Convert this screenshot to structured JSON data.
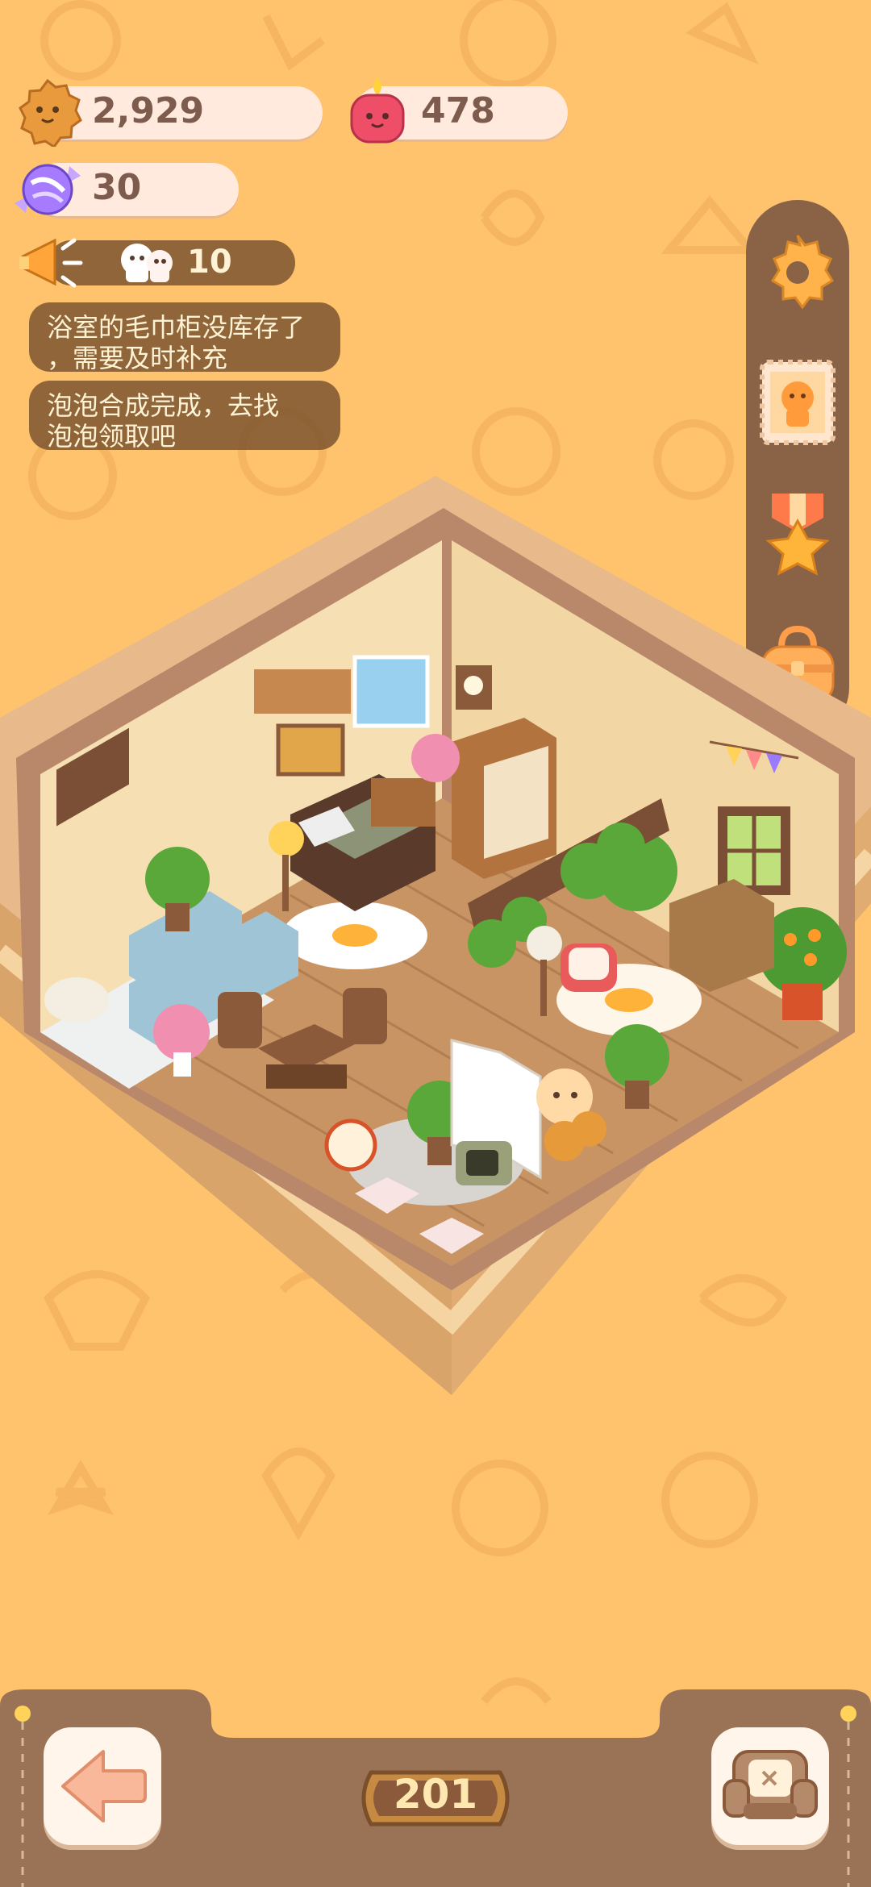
{
  "resources": {
    "cookie": {
      "icon": "cookie-face-icon",
      "value": "2,929"
    },
    "candle": {
      "icon": "red-candle-icon",
      "value": "478"
    },
    "candy": {
      "icon": "purple-candy-icon",
      "value": "30"
    }
  },
  "broadcast": {
    "icon": "megaphone-icon",
    "guest_icon": "ghost-guests-icon",
    "count": "10"
  },
  "notifications": [
    {
      "line1": "浴室的毛巾柜没库存了",
      "line2": "，需要及时补充"
    },
    {
      "line1": "泡泡合成完成，去找",
      "line2": "泡泡领取吧"
    }
  ],
  "side_menu": [
    {
      "name": "settings-gear-icon"
    },
    {
      "name": "character-stamp-icon"
    },
    {
      "name": "star-medal-icon"
    },
    {
      "name": "backpack-icon"
    }
  ],
  "bottom": {
    "back_icon": "arrow-left-icon",
    "furniture_icon": "armchair-icon",
    "level": "201"
  },
  "colors": {
    "background": "#ffc36e",
    "pill": "#ffeadd",
    "text": "#7d5b4d",
    "panel": "#8a6347"
  }
}
